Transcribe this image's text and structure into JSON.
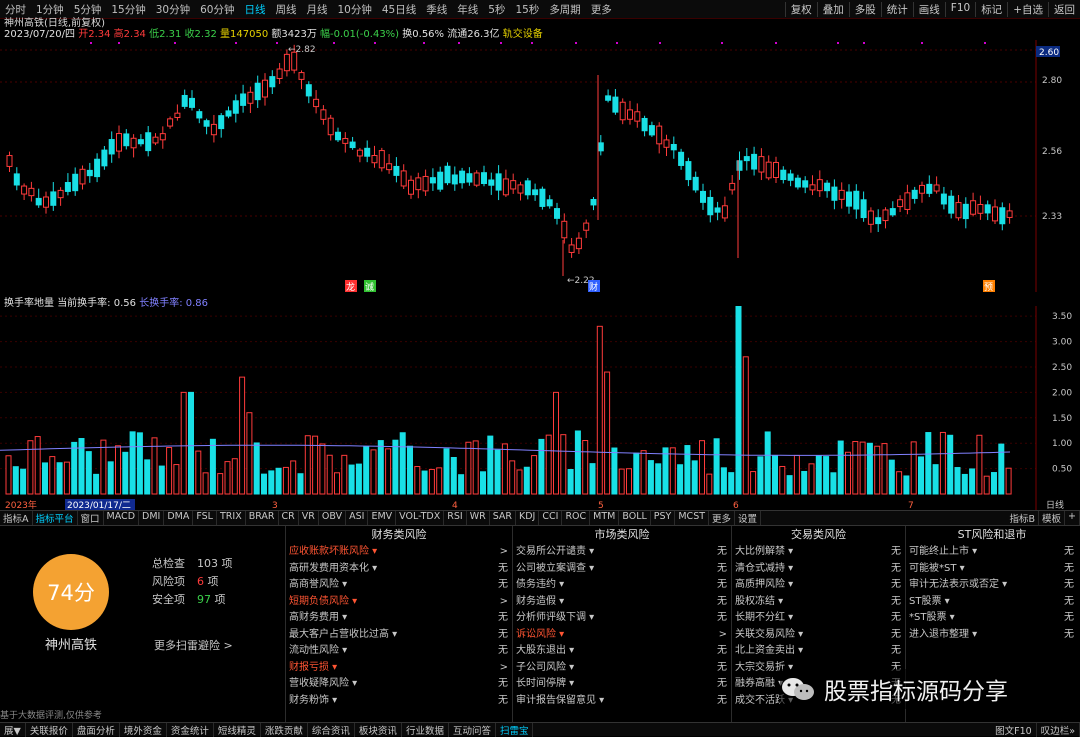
{
  "toolbar": {
    "periods": [
      "分时",
      "1分钟",
      "5分钟",
      "15分钟",
      "30分钟",
      "60分钟",
      "日线",
      "周线",
      "月线",
      "10分钟",
      "45日线",
      "季线",
      "年线",
      "5秒",
      "15秒",
      "多周期",
      "更多"
    ],
    "active_period": "日线",
    "tools": [
      "复权",
      "叠加",
      "多股",
      "统计",
      "画线",
      "F10",
      "标记",
      "+自选",
      "返回"
    ]
  },
  "stock": {
    "name_line": "神州高铁(日线,前复权)",
    "date": "2023/07/20/四",
    "open": "开2.34",
    "high": "高2.34",
    "low": "低2.31",
    "close": "收2.32",
    "volume": "量147050",
    "amount": "额3423万",
    "change": "幅-0.01(-0.43%)",
    "turnover": "换0.56%",
    "float_cap": "流通26.3亿",
    "sector": "轨交设备"
  },
  "price_axis": {
    "labels": [
      "2.80",
      "2.56",
      "2.33"
    ],
    "current_tag": "2.60"
  },
  "annotations": {
    "high": "2.82",
    "low": "2.22",
    "events": [
      "龙",
      "诚",
      "财",
      "预"
    ]
  },
  "colors": {
    "up": "#ff3b3b",
    "down": "#19e0e6",
    "accent": "#00d0ff",
    "score": "#f4a232"
  },
  "turnover_panel": {
    "title": "换手率地量",
    "current_label": "当前换手率: 0.56",
    "long_label": "长换手率: 0.86",
    "axis": [
      "3.50",
      "3.00",
      "2.50",
      "2.00",
      "1.50",
      "1.00",
      "0.50"
    ]
  },
  "time_axis": {
    "year": "2023年",
    "highlight": "2023/01/17/二",
    "months": [
      "3",
      "4",
      "5",
      "6",
      "7"
    ],
    "right_label": "日线"
  },
  "indicator_tabs": {
    "items": [
      "指标A",
      "指标平台",
      "窗口",
      "MACD",
      "DMI",
      "DMA",
      "FSL",
      "TRIX",
      "BRAR",
      "CR",
      "VR",
      "OBV",
      "ASI",
      "EMV",
      "VOL-TDX",
      "RSI",
      "WR",
      "SAR",
      "KDJ",
      "CCI",
      "ROC",
      "MTM",
      "BOLL",
      "PSY",
      "MCST",
      "更多",
      "设置"
    ],
    "active": "指标平台",
    "right": [
      "指标B",
      "模板",
      "+"
    ]
  },
  "risk": {
    "score": "74分",
    "stock_name": "神州高铁",
    "summary": [
      {
        "label": "总检查",
        "value": "103",
        "unit": "项"
      },
      {
        "label": "风险项",
        "value": "6",
        "unit": "项"
      },
      {
        "label": "安全项",
        "value": "97",
        "unit": "项"
      }
    ],
    "more_link": "更多扫雷避险 >",
    "footer_note": "基于大数据评测,仅供参考",
    "columns": [
      {
        "title": "财务类风险",
        "rows": [
          {
            "label": "应收账款坏账风险",
            "value": ">",
            "risk": true
          },
          {
            "label": "高研发费用资本化",
            "value": "无"
          },
          {
            "label": "高商誉风险",
            "value": "无"
          },
          {
            "label": "短期负债风险",
            "value": ">",
            "risk": true
          },
          {
            "label": "高财务费用",
            "value": "无"
          },
          {
            "label": "最大客户占营收比过高",
            "value": "无"
          },
          {
            "label": "流动性风险",
            "value": "无"
          },
          {
            "label": "财报亏损",
            "value": ">",
            "risk": true
          },
          {
            "label": "营收疑降风险",
            "value": "无"
          },
          {
            "label": "财务粉饰",
            "value": "无"
          }
        ]
      },
      {
        "title": "市场类风险",
        "rows": [
          {
            "label": "交易所公开谴责",
            "value": "无"
          },
          {
            "label": "公司被立案调查",
            "value": "无"
          },
          {
            "label": "债务违约",
            "value": "无"
          },
          {
            "label": "财务造假",
            "value": "无"
          },
          {
            "label": "分析师评级下调",
            "value": "无"
          },
          {
            "label": "诉讼风险",
            "value": ">",
            "risk": true
          },
          {
            "label": "大股东退出",
            "value": "无"
          },
          {
            "label": "子公司风险",
            "value": "无"
          },
          {
            "label": "长时间停牌",
            "value": "无"
          },
          {
            "label": "审计报告保留意见",
            "value": "无"
          }
        ]
      },
      {
        "title": "交易类风险",
        "rows": [
          {
            "label": "大比例解禁",
            "value": "无"
          },
          {
            "label": "清仓式减持",
            "value": "无"
          },
          {
            "label": "高质押风险",
            "value": "无"
          },
          {
            "label": "股权冻结",
            "value": "无"
          },
          {
            "label": "长期不分红",
            "value": "无"
          },
          {
            "label": "关联交易风险",
            "value": "无"
          },
          {
            "label": "北上资金卖出",
            "value": "无"
          },
          {
            "label": "大宗交易折",
            "value": "无"
          },
          {
            "label": "融券高融",
            "value": "无"
          },
          {
            "label": "成交不活跃",
            "value": "无"
          }
        ]
      },
      {
        "title": "ST风险和退市",
        "rows": [
          {
            "label": "可能终止上市",
            "value": "无"
          },
          {
            "label": "可能被*ST",
            "value": "无"
          },
          {
            "label": "审计无法表示或否定",
            "value": "无"
          },
          {
            "label": "ST股票",
            "value": "无"
          },
          {
            "label": "*ST股票",
            "value": "无"
          },
          {
            "label": "进入退市整理",
            "value": "无"
          }
        ]
      }
    ]
  },
  "watermark": "股票指标源码分享",
  "bottom_tabs": {
    "items": [
      "展▼",
      "关联报价",
      "盘面分析",
      "境外资金",
      "资金统计",
      "短线精灵",
      "涨跌贡献",
      "综合资讯",
      "板块资讯",
      "行业数据",
      "互动问答",
      "扫雷宝"
    ],
    "active": "扫雷宝",
    "right": [
      "图文F10",
      "叹边栏»"
    ]
  }
}
